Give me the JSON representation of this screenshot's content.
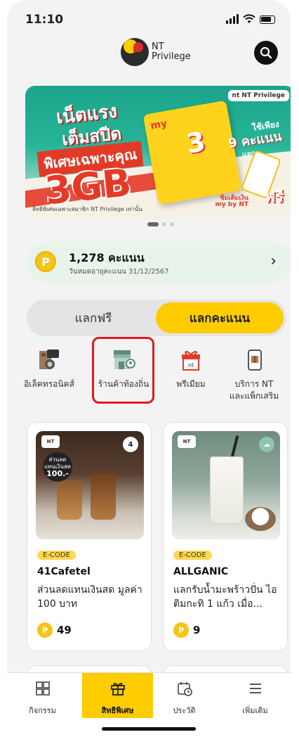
{
  "status_bar": {
    "time": "11:10"
  },
  "header": {
    "logo_line1": "NT",
    "logo_line2": "Privilege",
    "icons": {
      "search": "search-icon"
    }
  },
  "banner": {
    "headline1": "เน็ตแรง",
    "headline2": "เต็มสปีด",
    "headline3": "พิเศษเฉพาะคุณ",
    "big_text": "3GB",
    "card_brand": "my",
    "card_big": "3",
    "right_line1": "ใช้เพียง",
    "right_line2": "9 คะแนน",
    "right_line3": "แลก",
    "right_line4": "ซิมเติมเงิน",
    "right_line5": "my by NT",
    "right_big": "ฟรี",
    "nt_logo": "nt  NT Privilege",
    "note": "สิทธิพิเศษเฉพาะสมาชิก NT Privilege เท่านั้น"
  },
  "points": {
    "value": "1,278 คะแนน",
    "expiry": "วันหมดอายุคะแนน 31/12/2567",
    "coin": "P"
  },
  "tabs": [
    {
      "label": "แลกฟรี"
    },
    {
      "label": "แลกคะแนน"
    }
  ],
  "categories": [
    {
      "label": "อิเล็คทรอนิคส์",
      "icon": "electronics-icon"
    },
    {
      "label": "ร้านค้าท้องถิ่น",
      "icon": "local-store-icon"
    },
    {
      "label": "พรีเมียม",
      "icon": "gift-box-icon"
    },
    {
      "label": "บริการ NT\nและแพ็กเสริม",
      "icon": "phone-package-icon"
    }
  ],
  "cards": [
    {
      "tag": "E-CODE",
      "brand": "41Cafetel",
      "desc": "ส่วนลดแทนเงินสด มูลค่า 100 บาท",
      "points": "49",
      "badge_line1": "ส่วนลด",
      "badge_line2": "แทนเงินสด",
      "badge_amount": "100.-",
      "corner_logo": "4"
    },
    {
      "tag": "E-CODE",
      "brand": "ALLGANIC",
      "desc": "แลกรับน้ำมะพร้าวปั่น ไอติมกะทิ 1 แก้ว เมื่อ...",
      "points": "9",
      "corner_logo": ""
    }
  ],
  "bottom_nav": [
    {
      "label": "กิจกรรม",
      "icon": "activity-puzzle-icon"
    },
    {
      "label": "สิทธิพิเศษ",
      "icon": "gift-icon"
    },
    {
      "label": "ประวัติ",
      "icon": "calendar-history-icon"
    },
    {
      "label": "เพิ่มเติม",
      "icon": "menu-icon"
    }
  ],
  "colors": {
    "accent": "#ffcc00",
    "highlight": "#e3181f",
    "points_bg": "#e8f4ea"
  }
}
